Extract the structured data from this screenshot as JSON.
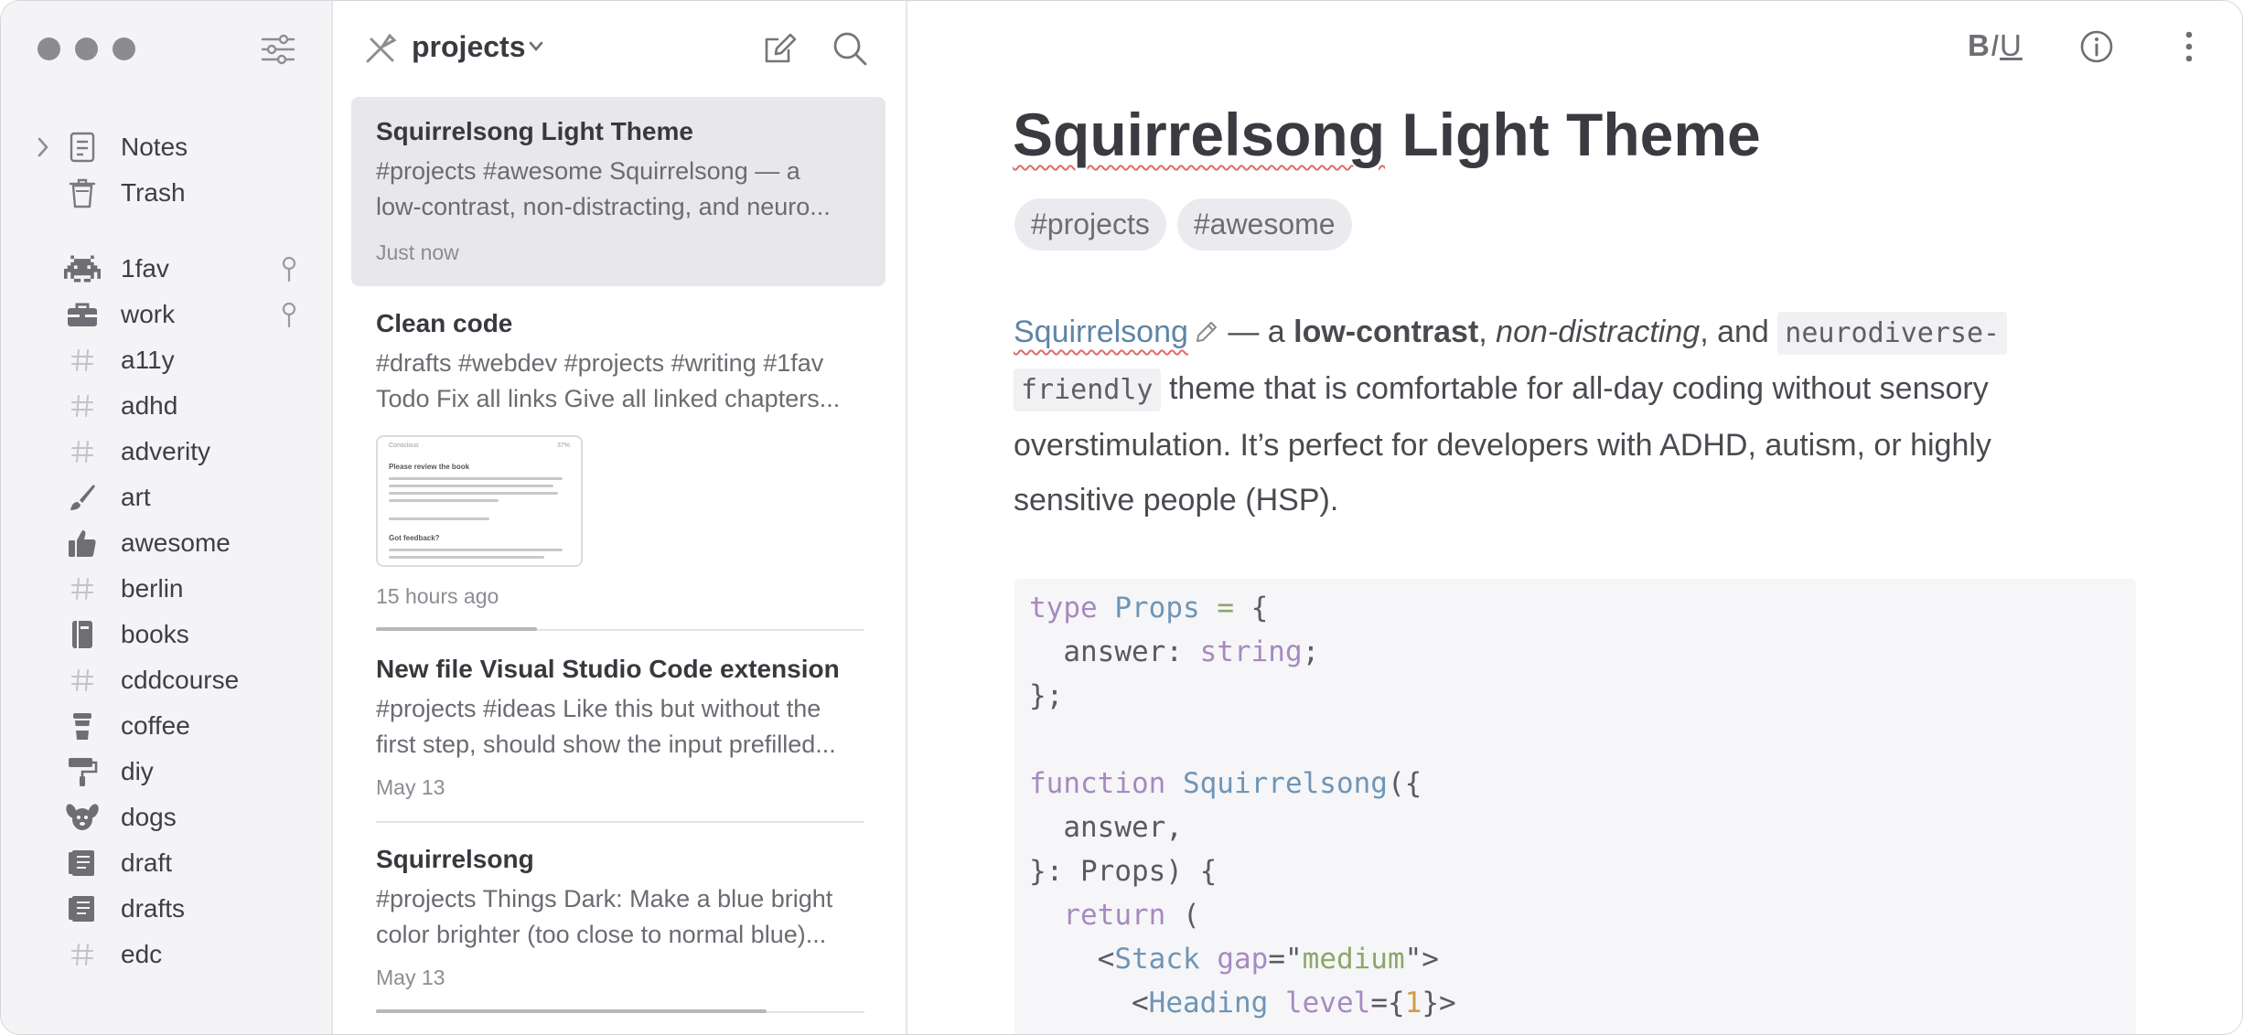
{
  "window": {
    "traffic_lights": [
      "close",
      "minimize",
      "zoom"
    ]
  },
  "sidebar": {
    "filter_icon": "sliders-icon",
    "items": [
      {
        "label": "Notes",
        "icon": "note-icon",
        "expandable": true
      },
      {
        "label": "Trash",
        "icon": "trash-icon"
      },
      {
        "label": "1fav",
        "icon": "space-invader-icon",
        "pinned": true
      },
      {
        "label": "work",
        "icon": "briefcase-icon",
        "pinned": true
      },
      {
        "label": "a11y",
        "icon": "hash-icon"
      },
      {
        "label": "adhd",
        "icon": "hash-icon"
      },
      {
        "label": "adverity",
        "icon": "hash-icon"
      },
      {
        "label": "art",
        "icon": "brush-icon"
      },
      {
        "label": "awesome",
        "icon": "thumbs-up-icon"
      },
      {
        "label": "berlin",
        "icon": "hash-icon"
      },
      {
        "label": "books",
        "icon": "book-icon"
      },
      {
        "label": "cddcourse",
        "icon": "hash-icon"
      },
      {
        "label": "coffee",
        "icon": "coffee-cup-icon"
      },
      {
        "label": "diy",
        "icon": "paint-roller-icon"
      },
      {
        "label": "dogs",
        "icon": "dog-icon"
      },
      {
        "label": "draft",
        "icon": "receipt-icon"
      },
      {
        "label": "drafts",
        "icon": "receipt-icon"
      },
      {
        "label": "edc",
        "icon": "hash-icon"
      }
    ]
  },
  "notelist": {
    "title": "projects",
    "title_icon": "tools-icon",
    "compose_icon": "compose-icon",
    "search_icon": "search-icon",
    "notes": [
      {
        "title": "Squirrelsong Light Theme",
        "preview": [
          "#projects #awesome Squirrelsong — a",
          "low-contrast, non-distracting, and neuro..."
        ],
        "date": "Just now",
        "selected": true
      },
      {
        "title": "Clean code",
        "preview": [
          "#drafts #webdev #projects #writing #1fav",
          "Todo Fix all links Give all linked chapters..."
        ],
        "date": "15 hours ago",
        "thumbnail": {
          "header": "Conscious",
          "page": "37%",
          "heading1": "Please review the book",
          "heading2": "Got feedback?"
        },
        "progress": 0.33
      },
      {
        "title": "New file Visual Studio Code extension",
        "preview": [
          "#projects #ideas Like this but without the",
          "first step, should show the input prefilled..."
        ],
        "date": "May 13"
      },
      {
        "title": "Squirrelsong",
        "preview": [
          "#projects Things Dark: Make a blue bright",
          "color brighter (too close to normal blue)..."
        ],
        "date": "May 13",
        "progress": 0.8
      }
    ]
  },
  "editor": {
    "format_b": "B",
    "format_i": "I",
    "format_u": "U",
    "info_icon": "info-icon",
    "more_icon": "more-vertical-icon",
    "title_word1": "Squirrelsong",
    "title_rest": " Light Theme",
    "tags": [
      "#projects",
      "#awesome"
    ],
    "para": {
      "link": "Squirrelsong",
      "t1": " — a ",
      "bold": "low-contrast",
      "t2": ", ",
      "italic": "non-distracting",
      "t3": ", and ",
      "code1": "neurodiverse-",
      "code2": "friendly",
      "line2_rest": " theme that is comfortable for all-day coding without sensory",
      "line3": "overstimulation. It’s perfect for developers with ADHD, autism, or highly",
      "line4": "sensitive people (HSP)."
    },
    "code_lines": [
      [
        [
          "k",
          "type"
        ],
        [
          "p",
          " "
        ],
        [
          "t",
          "Props"
        ],
        [
          "p",
          " "
        ],
        [
          "s",
          "="
        ],
        [
          "p",
          " {"
        ]
      ],
      [
        [
          "p",
          "  answer"
        ],
        [
          "p",
          ": "
        ],
        [
          "k",
          "string"
        ],
        [
          "p",
          ";"
        ]
      ],
      [
        [
          "p",
          "};"
        ]
      ],
      [
        [
          "p",
          ""
        ]
      ],
      [
        [
          "k",
          "function"
        ],
        [
          "p",
          " "
        ],
        [
          "t",
          "Squirrelsong"
        ],
        [
          "p",
          "({"
        ]
      ],
      [
        [
          "p",
          "  answer,"
        ]
      ],
      [
        [
          "p",
          "}: Props) {"
        ]
      ],
      [
        [
          "k",
          "  return"
        ],
        [
          "p",
          " ("
        ]
      ],
      [
        [
          "p",
          "    <"
        ],
        [
          "t",
          "Stack"
        ],
        [
          "p",
          " "
        ],
        [
          "k",
          "gap"
        ],
        [
          "p",
          "=\""
        ],
        [
          "s",
          "medium"
        ],
        [
          "p",
          "\">"
        ]
      ],
      [
        [
          "p",
          "      <"
        ],
        [
          "t",
          "Heading"
        ],
        [
          "p",
          " "
        ],
        [
          "k",
          "level"
        ],
        [
          "p",
          "={"
        ],
        [
          "n",
          "1"
        ],
        [
          "p",
          "}>"
        ]
      ]
    ]
  }
}
